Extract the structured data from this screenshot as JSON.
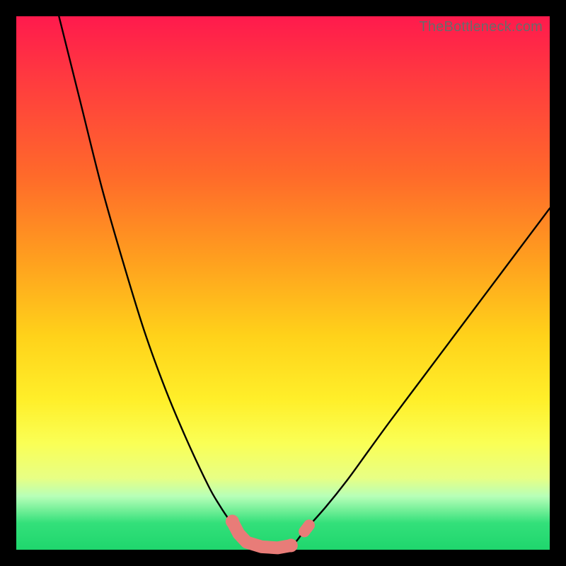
{
  "watermark": "TheBottleneck.com",
  "colors": {
    "page_bg": "#000000",
    "curve_stroke": "#000000",
    "marker_fill": "#e87c78",
    "marker_stroke": "#e87c78"
  },
  "chart_data": {
    "type": "line",
    "title": "",
    "xlabel": "",
    "ylabel": "",
    "xlim": [
      0,
      100
    ],
    "ylim": [
      0,
      100
    ],
    "grid": false,
    "series": [
      {
        "name": "left-branch",
        "x": [
          8,
          12,
          16,
          20,
          24,
          28,
          32,
          36,
          38,
          40,
          42
        ],
        "values": [
          100,
          84,
          68,
          54,
          41,
          30,
          20.5,
          12,
          8.5,
          5.5,
          3.2
        ]
      },
      {
        "name": "valley-flat",
        "x": [
          42,
          44,
          46,
          48,
          50,
          52,
          54
        ],
        "values": [
          3.2,
          1.4,
          0.6,
          0.3,
          0.5,
          1.1,
          3.5
        ]
      },
      {
        "name": "right-branch",
        "x": [
          54,
          58,
          62,
          66,
          70,
          76,
          82,
          88,
          94,
          100
        ],
        "values": [
          3.5,
          8,
          13,
          18.5,
          24,
          32,
          40,
          48,
          56,
          64
        ]
      }
    ],
    "markers": [
      {
        "name": "left-threshold-top",
        "x": 40.5,
        "y": 5.3
      },
      {
        "name": "left-threshold-bottom",
        "x": 41.7,
        "y": 3.0
      },
      {
        "name": "valley-start",
        "x": 43.2,
        "y": 1.4
      },
      {
        "name": "valley-mid-1",
        "x": 46.0,
        "y": 0.55
      },
      {
        "name": "valley-min",
        "x": 49.0,
        "y": 0.35
      },
      {
        "name": "valley-mid-2",
        "x": 51.5,
        "y": 0.8
      },
      {
        "name": "right-threshold-gap",
        "x": 54.0,
        "y": 3.4
      },
      {
        "name": "right-threshold-top",
        "x": 54.9,
        "y": 4.6
      }
    ]
  }
}
